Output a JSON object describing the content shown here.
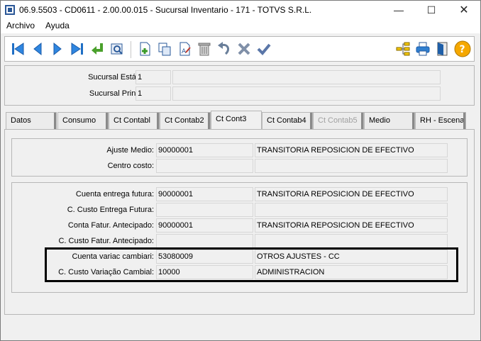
{
  "window": {
    "title": "06.9.5503 - CD0611 - 2.00.00.015 - Sucursal Inventario - 171 - TOTVS S.R.L.",
    "min_symbol": "—",
    "max_symbol": "☐",
    "close_symbol": "✕"
  },
  "menu": {
    "archivo": "Archivo",
    "ayuda": "Ayuda"
  },
  "toolbar": {
    "icons": [
      "first-icon",
      "prev-icon",
      "next-icon",
      "last-icon",
      "goto-icon",
      "search-icon",
      "new-icon",
      "copy-icon",
      "edit-icon",
      "delete-icon",
      "undo-icon",
      "cancel-icon",
      "confirm-icon",
      "tree-icon",
      "print-icon",
      "exit-icon",
      "help-icon"
    ],
    "help_symbol": "?"
  },
  "header": {
    "sucursal_estandar_label": "Sucursal Estándar:",
    "sucursal_estandar_value": "1",
    "sucursal_estandar_desc": "",
    "sucursal_principal_label": "Sucursal Principal:",
    "sucursal_principal_value": "1",
    "sucursal_principal_desc": ""
  },
  "tabs": [
    {
      "label": "Datos"
    },
    {
      "label": "Consumo"
    },
    {
      "label": "Ct Contabl"
    },
    {
      "label": "Ct Contab2"
    },
    {
      "label": "Ct Cont3"
    },
    {
      "label": "Ct Contab4"
    },
    {
      "label": "Ct Contab5"
    },
    {
      "label": "Medio"
    },
    {
      "label": "RH - Escena"
    }
  ],
  "group1": {
    "ajuste_medio_label": "Ajuste Medio:",
    "ajuste_medio_value": "90000001",
    "ajuste_medio_desc": "TRANSITORIA REPOSICION DE EFECTIVO",
    "centro_costo_label": "Centro costo:",
    "centro_costo_value": "",
    "centro_costo_desc": ""
  },
  "group2": {
    "rows": [
      {
        "label": "Cuenta entrega futura:",
        "value": "90000001",
        "desc": "TRANSITORIA REPOSICION DE EFECTIVO"
      },
      {
        "label": "C. Custo Entrega Futura:",
        "value": "",
        "desc": ""
      },
      {
        "label": "Conta Fatur. Antecipado:",
        "value": "90000001",
        "desc": "TRANSITORIA REPOSICION DE EFECTIVO"
      },
      {
        "label": "C. Custo Fatur. Antecipado:",
        "value": "",
        "desc": ""
      },
      {
        "label": "Cuenta variac cambiari:",
        "value": "53080009",
        "desc": "OTROS AJUSTES - CC"
      },
      {
        "label": "C. Custo Variação Cambial:",
        "value": "10000",
        "desc": "ADMINISTRACION"
      }
    ]
  }
}
